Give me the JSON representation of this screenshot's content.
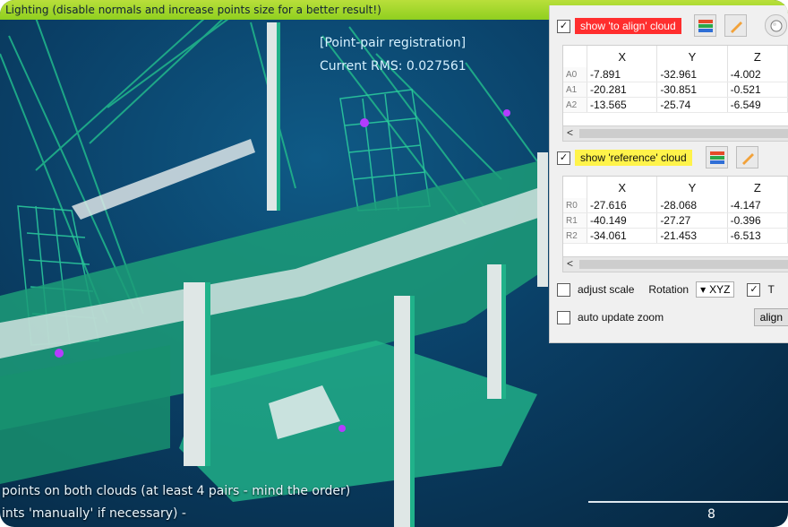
{
  "top_banner": {
    "text": "Lighting (disable normals and increase points size for a better result!)"
  },
  "overlay": {
    "title": "[Point-pair registration]",
    "rms": "Current RMS: 0.027561",
    "instruction_line1": "points on both clouds (at least 4 pairs - mind the order)",
    "instruction_line2": "ints 'manually' if necessary) -"
  },
  "scale_bar": {
    "label": "8"
  },
  "panel": {
    "to_align": {
      "checked": "✓",
      "label": "show 'to align' cloud",
      "columns": [
        "X",
        "Y",
        "Z"
      ],
      "rows": [
        {
          "id": "A0",
          "x": "-7.891",
          "y": "-32.961",
          "z": "-4.002"
        },
        {
          "id": "A1",
          "x": "-20.281",
          "y": "-30.851",
          "z": "-0.521"
        },
        {
          "id": "A2",
          "x": "-13.565",
          "y": "-25.74",
          "z": "-6.549"
        }
      ]
    },
    "reference": {
      "checked": "✓",
      "label": "show 'reference' cloud",
      "columns": [
        "X",
        "Y",
        "Z"
      ],
      "rows": [
        {
          "id": "R0",
          "x": "-27.616",
          "y": "-28.068",
          "z": "-4.147"
        },
        {
          "id": "R1",
          "x": "-40.149",
          "y": "-27.27",
          "z": "-0.396"
        },
        {
          "id": "R2",
          "x": "-34.061",
          "y": "-21.453",
          "z": "-6.513"
        }
      ]
    },
    "adjust_scale_label": "adjust scale",
    "rotation_label": "Rotation",
    "rotation_value": "XYZ",
    "translation_checked": "✓",
    "translation_label": "T",
    "auto_update_zoom_label": "auto update zoom",
    "align_button": "align"
  },
  "scroll_arrow": "<",
  "colors": {
    "cloud": "#22b58a",
    "highlight": "#f2f2f2",
    "picked": "#b43cff"
  }
}
